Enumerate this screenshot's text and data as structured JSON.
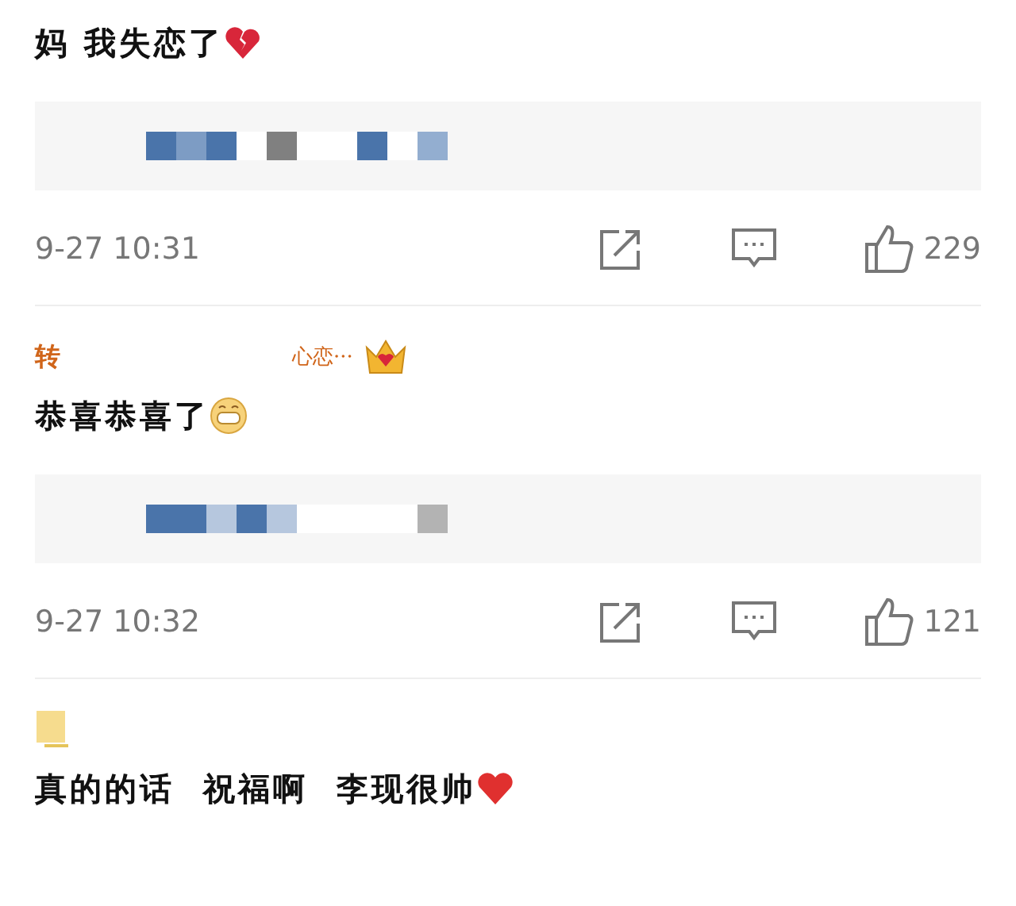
{
  "comments": [
    {
      "text": "妈 我失恋了",
      "emoji": {
        "kind": "broken-heart"
      },
      "quote": {
        "blocks": [
          {
            "color": "#4a74aa"
          },
          {
            "color": "#7d9cc4"
          },
          {
            "color": "#4a74aa"
          },
          {
            "color": "#ffffff"
          },
          {
            "color": "#808080"
          },
          {
            "color": "#ffffff"
          },
          {
            "color": "#ffffff"
          },
          {
            "color": "#4a74aa"
          },
          {
            "color": "#ffffff"
          },
          {
            "color": "#93aed0"
          }
        ]
      },
      "time": "9-27 10:31",
      "likes": "229"
    },
    {
      "header": {
        "name": "转",
        "suffix": "心恋···",
        "badge": {
          "kind": "crown"
        }
      },
      "text": "恭喜恭喜了",
      "emoji": {
        "kind": "grin"
      },
      "quote": {
        "blocks": [
          {
            "color": "#4a74aa"
          },
          {
            "color": "#4a74aa"
          },
          {
            "color": "#b6c7de"
          },
          {
            "color": "#4a74aa"
          },
          {
            "color": "#b6c7de"
          },
          {
            "color": "#ffffff"
          },
          {
            "color": "#ffffff"
          },
          {
            "color": "#ffffff"
          },
          {
            "color": "#ffffff"
          },
          {
            "color": "#b3b3b3"
          }
        ]
      },
      "time": "9-27 10:32",
      "likes": "121"
    },
    {
      "header": {
        "badge": {
          "kind": "note"
        }
      },
      "text": "真的的话  祝福啊  李现很帅",
      "emoji": {
        "kind": "heart"
      }
    }
  ]
}
